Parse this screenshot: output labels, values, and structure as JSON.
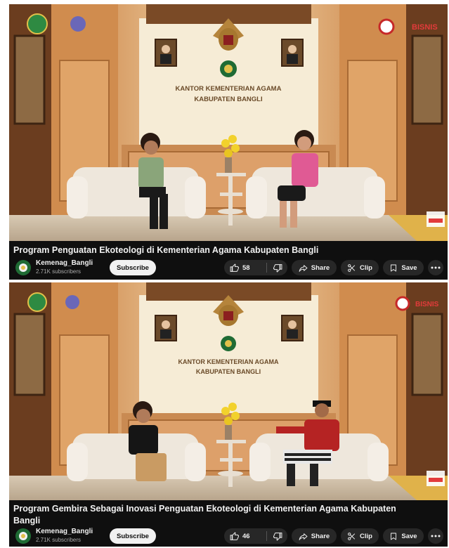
{
  "videos": [
    {
      "title": "Program Penguatan Ekoteologi di Kementerian Agama Kabupaten Bangli",
      "channel": "Kemenag_Bangli",
      "subscribers": "2.71K subscribers",
      "subscribe_label": "Subscribe",
      "likes": "58",
      "share_label": "Share",
      "clip_label": "Clip",
      "save_label": "Save",
      "set_sign_line1": "KANTOR KEMENTERIAN AGAMA",
      "set_sign_line2": "KABUPATEN BANGLI",
      "brand_logo": "BISNIS"
    },
    {
      "title": "Program Gembira Sebagai Inovasi Penguatan Ekoteologi di Kementerian Agama Kabupaten Bangli",
      "channel": "Kemenag_Bangli",
      "subscribers": "2.71K subscribers",
      "subscribe_label": "Subscribe",
      "likes": "46",
      "share_label": "Share",
      "clip_label": "Clip",
      "save_label": "Save",
      "set_sign_line1": "KANTOR KEMENTERIAN AGAMA",
      "set_sign_line2": "KABUPATEN BANGLI",
      "brand_logo": "BISNIS"
    }
  ],
  "icons": {
    "like": "thumbs-up-icon",
    "dislike": "thumbs-down-icon",
    "share": "share-arrow-icon",
    "clip": "scissors-icon",
    "save": "bookmark-icon",
    "more": "more-horizontal-icon"
  },
  "colors": {
    "background": "#0f0f0f",
    "pill": "#272727",
    "text": "#f1f1f1",
    "subtext": "#aaaaaa",
    "subscribe_bg": "#f1f1f1",
    "wood": "#c98a52"
  }
}
